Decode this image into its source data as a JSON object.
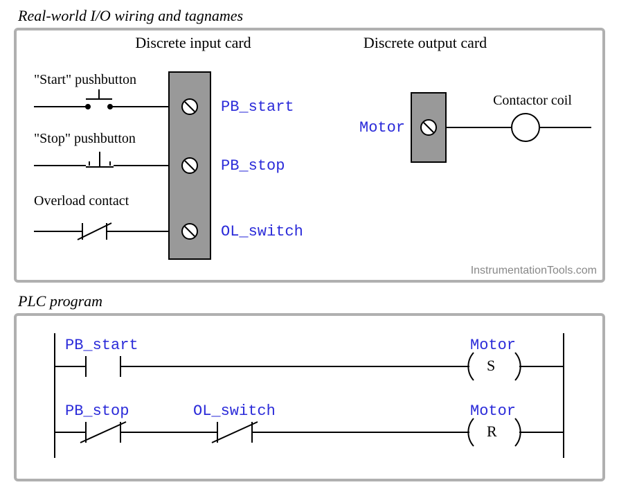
{
  "section1": {
    "title": "Real-world I/O wiring and tagnames",
    "input_card_label": "Discrete input card",
    "output_card_label": "Discrete output card",
    "start_label": "\"Start\" pushbutton",
    "stop_label": "\"Stop\" pushbutton",
    "overload_label": "Overload contact",
    "tag_start": "PB_start",
    "tag_stop": "PB_stop",
    "tag_ol": "OL_switch",
    "tag_motor": "Motor",
    "contactor_label": "Contactor coil",
    "credit": "InstrumentationTools.com"
  },
  "section2": {
    "title": "PLC program",
    "rung1": {
      "contact1": "PB_start",
      "coil_tag": "Motor",
      "coil_letter": "S"
    },
    "rung2": {
      "contact1": "PB_stop",
      "contact2": "OL_switch",
      "coil_tag": "Motor",
      "coil_letter": "R"
    }
  }
}
